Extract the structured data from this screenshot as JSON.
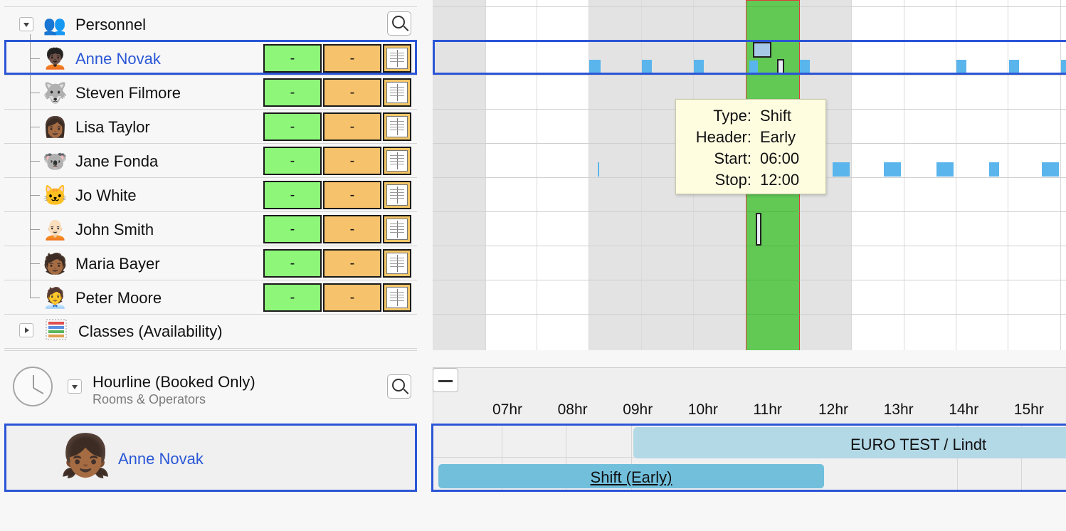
{
  "tree": {
    "group_label": "Personnel",
    "people": [
      {
        "name": "Anne Novak",
        "avatar": "🧑🏿‍🦱",
        "green": "-",
        "orange": "-"
      },
      {
        "name": "Steven Filmore",
        "avatar": "🐺",
        "green": "-",
        "orange": "-"
      },
      {
        "name": "Lisa Taylor",
        "avatar": "👩🏾",
        "green": "-",
        "orange": "-"
      },
      {
        "name": "Jane Fonda",
        "avatar": "🐨",
        "green": "-",
        "orange": "-"
      },
      {
        "name": "Jo White",
        "avatar": "🐱",
        "green": "-",
        "orange": "-"
      },
      {
        "name": "John Smith",
        "avatar": "🧑🏻‍🦲",
        "green": "-",
        "orange": "-"
      },
      {
        "name": "Maria Bayer",
        "avatar": "🧑🏾",
        "green": "-",
        "orange": "-"
      },
      {
        "name": "Peter Moore",
        "avatar": "🧑‍💼",
        "green": "-",
        "orange": "-"
      }
    ],
    "classes_label": "Classes (Availability)"
  },
  "tooltip": {
    "type_key": "Type:",
    "type_val": "Shift",
    "header_key": "Header:",
    "header_val": "Early",
    "start_key": "Start:",
    "start_val": "06:00",
    "stop_key": "Stop:",
    "stop_val": "12:00"
  },
  "hourline": {
    "title": "Hourline (Booked Only)",
    "subtitle": "Rooms & Operators",
    "hours": [
      "07hr",
      "08hr",
      "09hr",
      "10hr",
      "11hr",
      "12hr",
      "13hr",
      "14hr",
      "15hr"
    ],
    "booked_person": "Anne Novak",
    "booked_avatar": "👧🏾",
    "booking_bar": "EURO TEST / Lindt",
    "shift_bar": "Shift (Early)"
  },
  "colors": {
    "selection": "#2b55d6",
    "current_hour": "#62c955",
    "current_hour_border": "#e33b3b",
    "available": "#8ef77a",
    "booked": "#f6c26b",
    "event": "#5ab5ec",
    "tooltip_bg": "#fffde0"
  }
}
